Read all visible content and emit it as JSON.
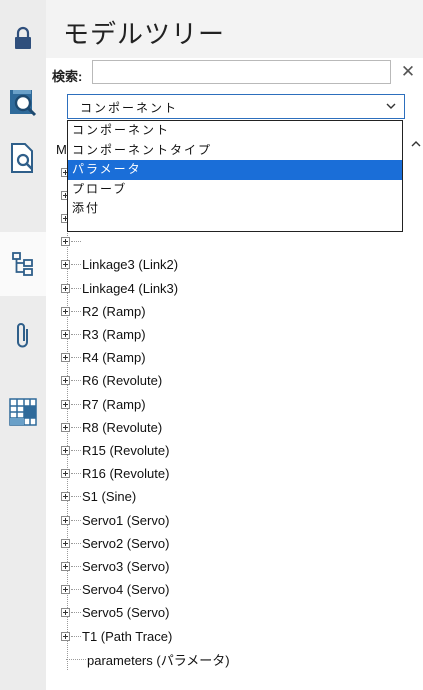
{
  "panel": {
    "title": "モデルツリー",
    "search_label": "検索:",
    "search_value": "",
    "search_clear": "✕"
  },
  "rail": {
    "items": [
      {
        "icon": "lock-icon"
      },
      {
        "icon": "search-view-icon"
      },
      {
        "icon": "document-search-icon"
      },
      {
        "icon": "tree-structure-icon"
      },
      {
        "icon": "paperclip-icon"
      },
      {
        "icon": "grid-table-icon"
      }
    ]
  },
  "filter": {
    "selected": "コンポーネント",
    "options": [
      "コンポーネント",
      "コンポーネントタイプ",
      "パラメータ",
      "プローブ",
      "添付"
    ],
    "highlighted": "パラメータ"
  },
  "tree": {
    "header": "M",
    "rows": [
      "",
      "",
      "",
      "",
      "Linkage3 (Link2)",
      "Linkage4 (Link3)",
      "R2 (Ramp)",
      "R3 (Ramp)",
      "R4 (Ramp)",
      "R6 (Revolute)",
      "R7 (Ramp)",
      "R8 (Revolute)",
      "R15 (Revolute)",
      "R16 (Revolute)",
      "S1 (Sine)",
      "Servo1 (Servo)",
      "Servo2 (Servo)",
      "Servo3 (Servo)",
      "Servo4 (Servo)",
      "Servo5 (Servo)",
      "T1 (Path Trace)"
    ],
    "leaf": "parameters (パラメータ)"
  }
}
